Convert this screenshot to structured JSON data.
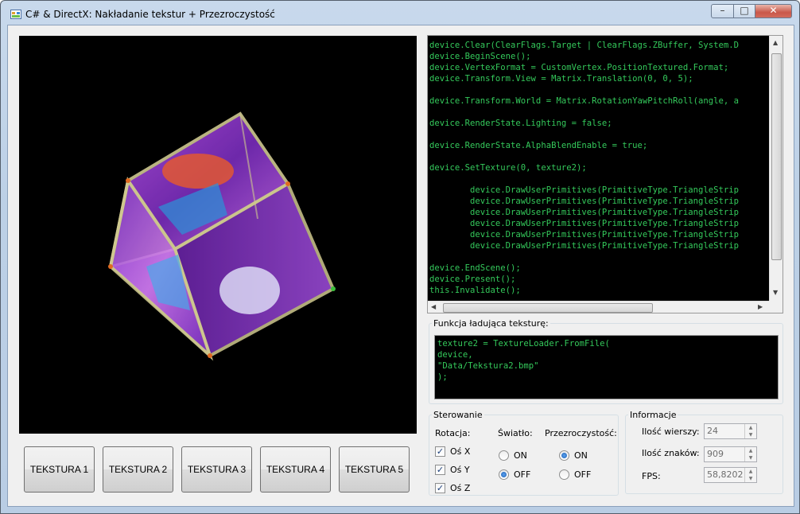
{
  "window": {
    "title": "C# & DirectX: Nakładanie tekstur + Przezroczystość",
    "controls": {
      "minimize": "–",
      "maximize": "□",
      "close": "✕"
    }
  },
  "viewport": {
    "icon": "textured-cube",
    "colors": {
      "background": "#000000",
      "face": "#9b3fd6",
      "frame": "#c9c38a"
    }
  },
  "texture_buttons": [
    "TEKSTURA 1",
    "TEKSTURA 2",
    "TEKSTURA 3",
    "TEKSTURA 4",
    "TEKSTURA 5"
  ],
  "code_listing": {
    "lines": [
      "device.Clear(ClearFlags.Target | ClearFlags.ZBuffer, System.D",
      "device.BeginScene();",
      "device.VertexFormat = CustomVertex.PositionTextured.Format;",
      "device.Transform.View = Matrix.Translation(0, 0, 5);",
      "",
      "device.Transform.World = Matrix.RotationYawPitchRoll(angle, a",
      "",
      "device.RenderState.Lighting = false;",
      "",
      "device.RenderState.AlphaBlendEnable = true;",
      "",
      "device.SetTexture(0, texture2);",
      "",
      "        device.DrawUserPrimitives(PrimitiveType.TriangleStrip",
      "        device.DrawUserPrimitives(PrimitiveType.TriangleStrip",
      "        device.DrawUserPrimitives(PrimitiveType.TriangleStrip",
      "        device.DrawUserPrimitives(PrimitiveType.TriangleStrip",
      "        device.DrawUserPrimitives(PrimitiveType.TriangleStrip",
      "        device.DrawUserPrimitives(PrimitiveType.TriangleStrip",
      "",
      "device.EndScene();",
      "device.Present();",
      "this.Invalidate();"
    ],
    "text_color": "#34c95b"
  },
  "loader": {
    "label": "Funkcja ładująca teksturę:",
    "lines": [
      "texture2 = TextureLoader.FromFile(",
      "device,",
      "\"Data/Tekstura2.bmp\"",
      ");"
    ]
  },
  "controls_group": {
    "label": "Sterowanie",
    "rotation": {
      "label": "Rotacja:",
      "axes": [
        {
          "label": "Oś X",
          "checked": true
        },
        {
          "label": "Oś Y",
          "checked": true
        },
        {
          "label": "Oś Z",
          "checked": true
        }
      ]
    },
    "light": {
      "label": "Światło:",
      "options": [
        {
          "label": "ON",
          "selected": false
        },
        {
          "label": "OFF",
          "selected": true
        }
      ]
    },
    "transparency": {
      "label": "Przezroczystość:",
      "options": [
        {
          "label": "ON",
          "selected": true
        },
        {
          "label": "OFF",
          "selected": false
        }
      ]
    }
  },
  "info_group": {
    "label": "Informacje",
    "rows": [
      {
        "label": "Ilość wierszy:",
        "value": "24"
      },
      {
        "label": "Ilość znaków:",
        "value": "909"
      },
      {
        "label": "FPS:",
        "value": "58,8202"
      }
    ]
  }
}
